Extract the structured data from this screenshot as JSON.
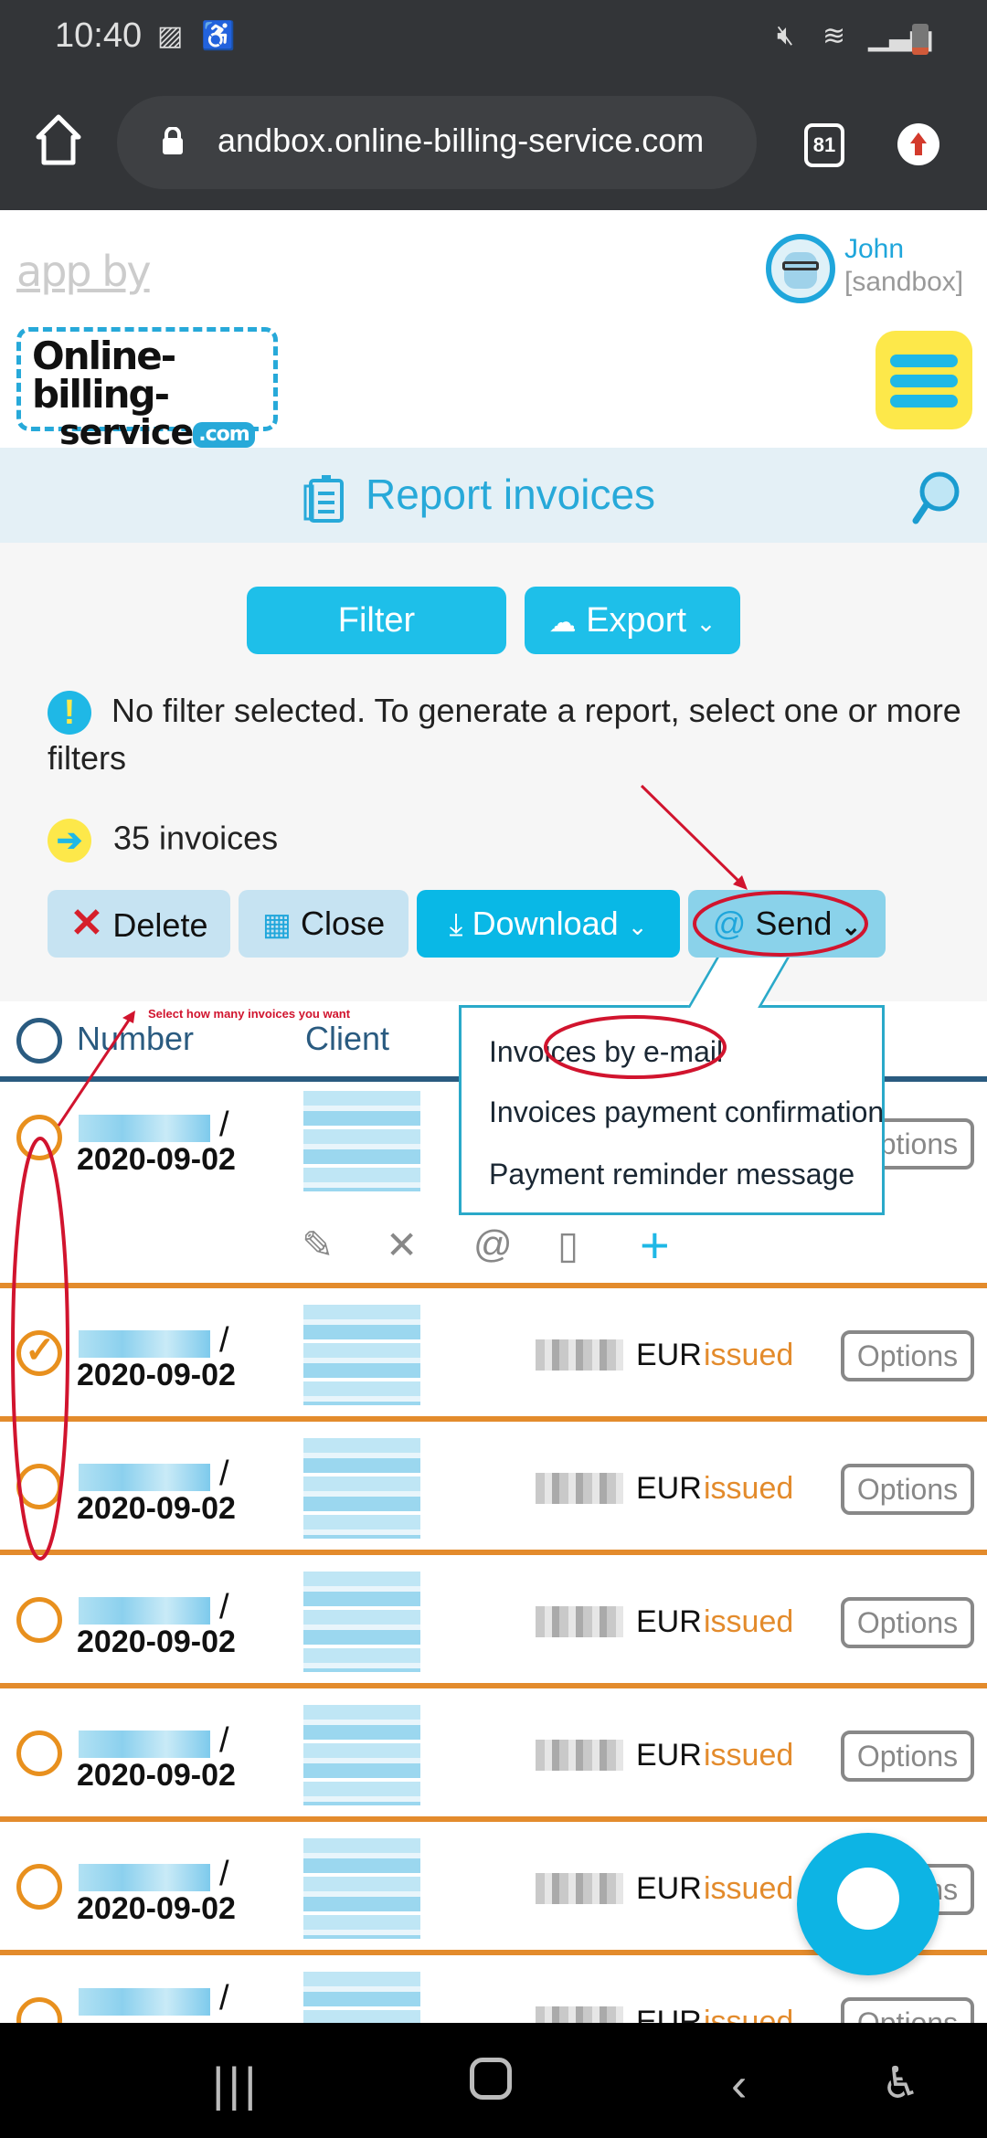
{
  "status_bar": {
    "time": "10:40",
    "icons": [
      "image-icon",
      "accessibility-notification-icon",
      "mute-icon",
      "wifi-icon",
      "signal-icon",
      "battery-low-icon"
    ]
  },
  "browser": {
    "url": "andbox.online-billing-service.com",
    "tab_count": "81"
  },
  "header": {
    "app_by": "app by",
    "logo_line1": "Online-billing-",
    "logo_line2": "service",
    "logo_com": ".com",
    "user_name": "John",
    "user_sub": "[sandbox]"
  },
  "page": {
    "title": "Report invoices"
  },
  "toolbar": {
    "filter_label": "Filter",
    "export_label": "Export"
  },
  "info": {
    "no_filter": "No filter selected. To generate a report, select one or more filters",
    "count": "35 invoices"
  },
  "actions": {
    "delete": "Delete",
    "close": "Close",
    "download": "Download",
    "send": "Send"
  },
  "send_menu": {
    "items": [
      "Invoices by e-mail",
      "Invoices payment confirmation",
      "Payment reminder message"
    ]
  },
  "table": {
    "headers": {
      "number": "Number",
      "client": "Client"
    },
    "rows": [
      {
        "date": "2020-09-02",
        "currency": "",
        "status": "",
        "options": "Options",
        "checked": false
      },
      {
        "date": "2020-09-02",
        "currency": "EUR",
        "status": "issued",
        "options": "Options",
        "checked": true
      },
      {
        "date": "2020-09-02",
        "currency": "EUR",
        "status": "issued",
        "options": "Options",
        "checked": false
      },
      {
        "date": "2020-09-02",
        "currency": "EUR",
        "status": "issued",
        "options": "Options",
        "checked": false
      },
      {
        "date": "2020-09-02",
        "currency": "EUR",
        "status": "issued",
        "options": "Options",
        "checked": false
      },
      {
        "date": "2020-09-02",
        "currency": "EUR",
        "status": "issued",
        "options": "Options",
        "checked": false
      },
      {
        "date": "",
        "currency": "EUR",
        "status": "issued",
        "options": "Options",
        "checked": false
      }
    ],
    "row_action_icons": [
      "edit-icon",
      "delete-icon",
      "email-icon",
      "payment-icon",
      "add-icon"
    ]
  },
  "annotation": {
    "hint": "Select how many invoices you want"
  },
  "colors": {
    "accent": "#1ebfe9",
    "status_issued": "#e38b2c",
    "annotation": "#d1142e",
    "menu_button": "#fde84a"
  }
}
